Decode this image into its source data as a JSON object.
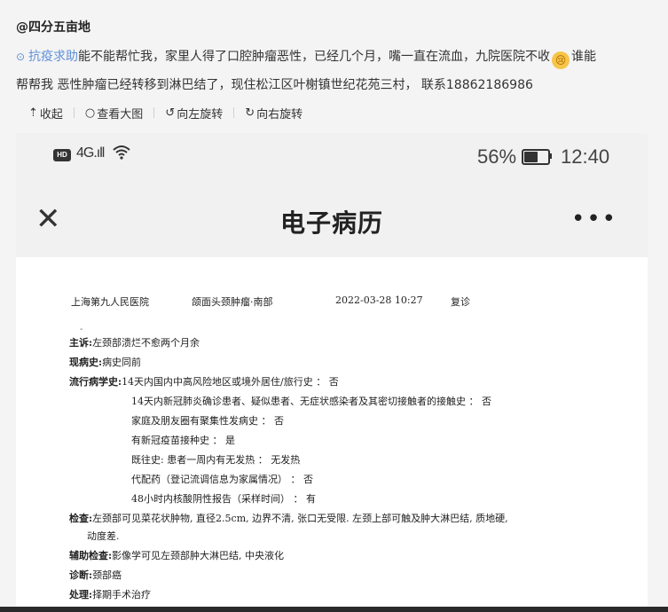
{
  "post": {
    "username": "@四分五亩地",
    "topic_icon": "link-chain-icon",
    "topic": "抗疫求助",
    "text_part1": "能不能帮忙我，家里人得了口腔肿瘤恶性，已经几个月，嘴一直在流血，九院医院不收",
    "emoji": "crying-face-emoji",
    "text_part2": "谁能",
    "line2": "帮帮我 恶性肿瘤已经转移到淋巴结了，现住松江区叶榭镇世纪花苑三村， 联系18862186986"
  },
  "toolbar": {
    "collapse": "收起",
    "view_large": "查看大图",
    "rotate_left": "向左旋转",
    "rotate_right": "向右旋转"
  },
  "phone": {
    "hd": "HD",
    "signal": "4G.ıll",
    "battery_percent": "56%",
    "battery_level": 0.56,
    "time": "12:40",
    "title": "电子病历",
    "more": "•••"
  },
  "record": {
    "hospital": "上海第九人民医院",
    "department": "颌面头颈肿瘤·南部",
    "datetime": "2022-03-28 10:27",
    "visit_type": "复诊",
    "dash": "-",
    "chief_label": "主诉:",
    "chief": "左颈部溃烂不愈两个月余",
    "history_label": "现病史:",
    "history": "病史同前",
    "epi_label": "流行病学史:",
    "epi1": "14天内国内中高风险地区或境外居住/旅行史 ： 否",
    "epi2": "14天内新冠肺炎确诊患者、疑似患者、无症状感染者及其密切接触者的接触史 ： 否",
    "epi3": "家庭及朋友圈有聚集性发病史 ： 否",
    "epi4": "有新冠疫苗接种史 ： 是",
    "epi5": "既往史: 患者一周内有无发热 ： 无发热",
    "epi6": "代配药（登记流调信息为家属情况） ： 否",
    "epi7": "48小时内核酸阴性报告（采样时间） ： 有",
    "exam_label": "检查:",
    "exam1": "左颈部可见菜花状肿物, 直径2.5cm, 边界不清, 张口无受限. 左颈上部可触及肿大淋巴结, 质地硬,",
    "exam2": "动度差.",
    "aux_label": "辅助检查:",
    "aux": "影像学可见左颈部肿大淋巴结, 中央液化",
    "diag_label": "诊断:",
    "diag": "颈部癌",
    "treat_label": "处理:",
    "treat": "择期手术治疗"
  }
}
